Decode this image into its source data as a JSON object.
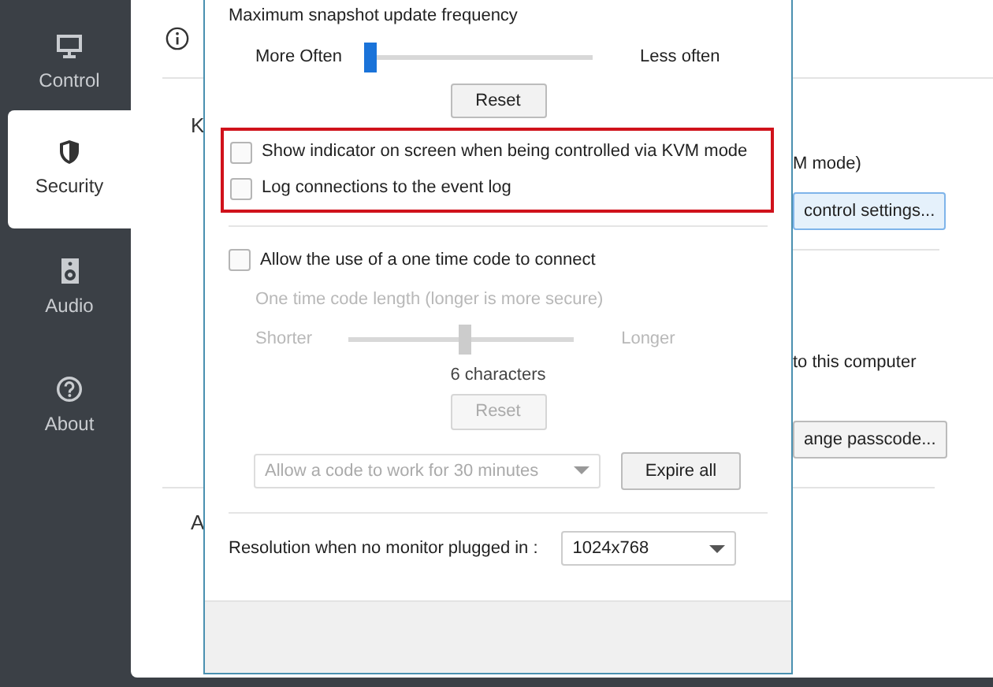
{
  "sidebar": {
    "items": [
      {
        "label": "Control",
        "selected": false
      },
      {
        "label": "Security",
        "selected": true
      },
      {
        "label": "Audio",
        "selected": false
      },
      {
        "label": "About",
        "selected": false
      }
    ]
  },
  "background_panel": {
    "heading_fragment": "K",
    "kvm_text": "M mode)",
    "control_button": "control settings...",
    "computer_text": "to this computer",
    "passcode_button": "ange passcode...",
    "bottom_fragment": "A"
  },
  "dialog": {
    "snapshot": {
      "label": "Maximum snapshot update frequency",
      "min_label": "More Often",
      "max_label": "Less often",
      "level": 0,
      "reset": "Reset"
    },
    "highlighted_options": [
      {
        "label": "Show indicator on screen when being controlled via KVM mode",
        "checked": false
      },
      {
        "label": "Log connections to the event log",
        "checked": false
      }
    ],
    "one_time_code": {
      "label": "Allow the use of a one time code to connect",
      "checked": false,
      "disabled": true,
      "length_label": "One time code length (longer is more secure)",
      "min_label": "Shorter",
      "max_label": "Longer",
      "level": 0.5,
      "value_text": "6 characters",
      "reset": "Reset",
      "duration": "Allow a code to work for 30 minutes",
      "expire_button": "Expire all"
    },
    "resolution": {
      "label": "Resolution when no monitor plugged in :",
      "value": "1024x768"
    }
  }
}
